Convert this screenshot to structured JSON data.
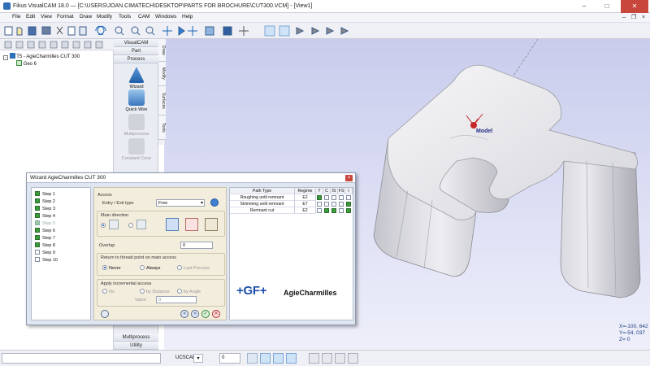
{
  "window": {
    "title": "Fikus VisualCAM 18.0 — [C:\\USERS\\JOAN.CIMATECH\\DESKTOP\\PARTS FOR BROCHURE\\CUT300.VCM] - [View1]"
  },
  "menu": [
    "File",
    "Edit",
    "View",
    "Format",
    "Draw",
    "Modify",
    "Tools",
    "CAM",
    "Windows",
    "Help"
  ],
  "tree": {
    "root": "T5 - AgieCharmilles CUT 300",
    "child": "Geo 6"
  },
  "vpanel": {
    "top_buttons": [
      "VisualCAM",
      "Part",
      "Process"
    ],
    "tools": [
      "Wizard",
      "Quick Wire",
      "Multiprocess",
      "Constant Cone"
    ],
    "bottom_buttons": [
      "Multiprocess",
      "Utility"
    ]
  },
  "vtabs": [
    "Draw",
    "Modify",
    "Surfaces",
    "Tools"
  ],
  "viewport": {
    "model_label": "Model"
  },
  "coords": {
    "x": "X=-100, 642",
    "y": "Y=-54, 037",
    "z": "Z= 0"
  },
  "statusbar": {
    "ucs": "UCSCAN",
    "layer": "0"
  },
  "dialog": {
    "title": "Wizard AgieCharmilles CUT 300",
    "steps": [
      {
        "label": "Step 1",
        "checked": true,
        "enabled": true
      },
      {
        "label": "Step 2",
        "checked": true,
        "enabled": true
      },
      {
        "label": "Step 3",
        "checked": true,
        "enabled": true
      },
      {
        "label": "Step 4",
        "checked": true,
        "enabled": true
      },
      {
        "label": "Step 5",
        "checked": true,
        "enabled": false
      },
      {
        "label": "Step 6",
        "checked": true,
        "enabled": true
      },
      {
        "label": "Step 7",
        "checked": true,
        "enabled": true
      },
      {
        "label": "Step 8",
        "checked": true,
        "enabled": true
      },
      {
        "label": "Step 9",
        "checked": false,
        "enabled": true
      },
      {
        "label": "Step 10",
        "checked": false,
        "enabled": true
      }
    ],
    "access": {
      "group": "Access",
      "entry_label": "Entry / Exit type",
      "entry_value": "Free",
      "main_direction": "Main direction",
      "overlap_label": "Overlap",
      "overlap_value": "0"
    },
    "return_group": {
      "title": "Return to thread point on main access",
      "options": [
        "Never",
        "Always",
        "Last Process"
      ],
      "selected": "Never"
    },
    "incremental": {
      "title": "Apply incremental access",
      "options": [
        "No",
        "by Distance",
        "by Angle"
      ],
      "value_label": "Value",
      "value": "0"
    },
    "table": {
      "headers": [
        "Path Type",
        "Regime",
        "T",
        "C",
        "IS",
        "FS",
        "I"
      ],
      "rows": [
        {
          "path": "Roughing until remnant",
          "regime": "E2",
          "checks": [
            true,
            false,
            false,
            false,
            false
          ]
        },
        {
          "path": "Skimming until remnant",
          "regime": "E7",
          "checks": [
            false,
            false,
            false,
            false,
            true
          ]
        },
        {
          "path": "Remnant cut",
          "regime": "E2",
          "checks": [
            false,
            true,
            true,
            false,
            true
          ]
        }
      ]
    },
    "logo": {
      "gf": "+GF+",
      "brand": "AgieCharmilles"
    }
  },
  "colors": {
    "accent": "#2f6fb5",
    "check_on": "#3d9b3d",
    "viewport_top": "#c9ccec",
    "dialog_bg": "#dfe6f2"
  }
}
